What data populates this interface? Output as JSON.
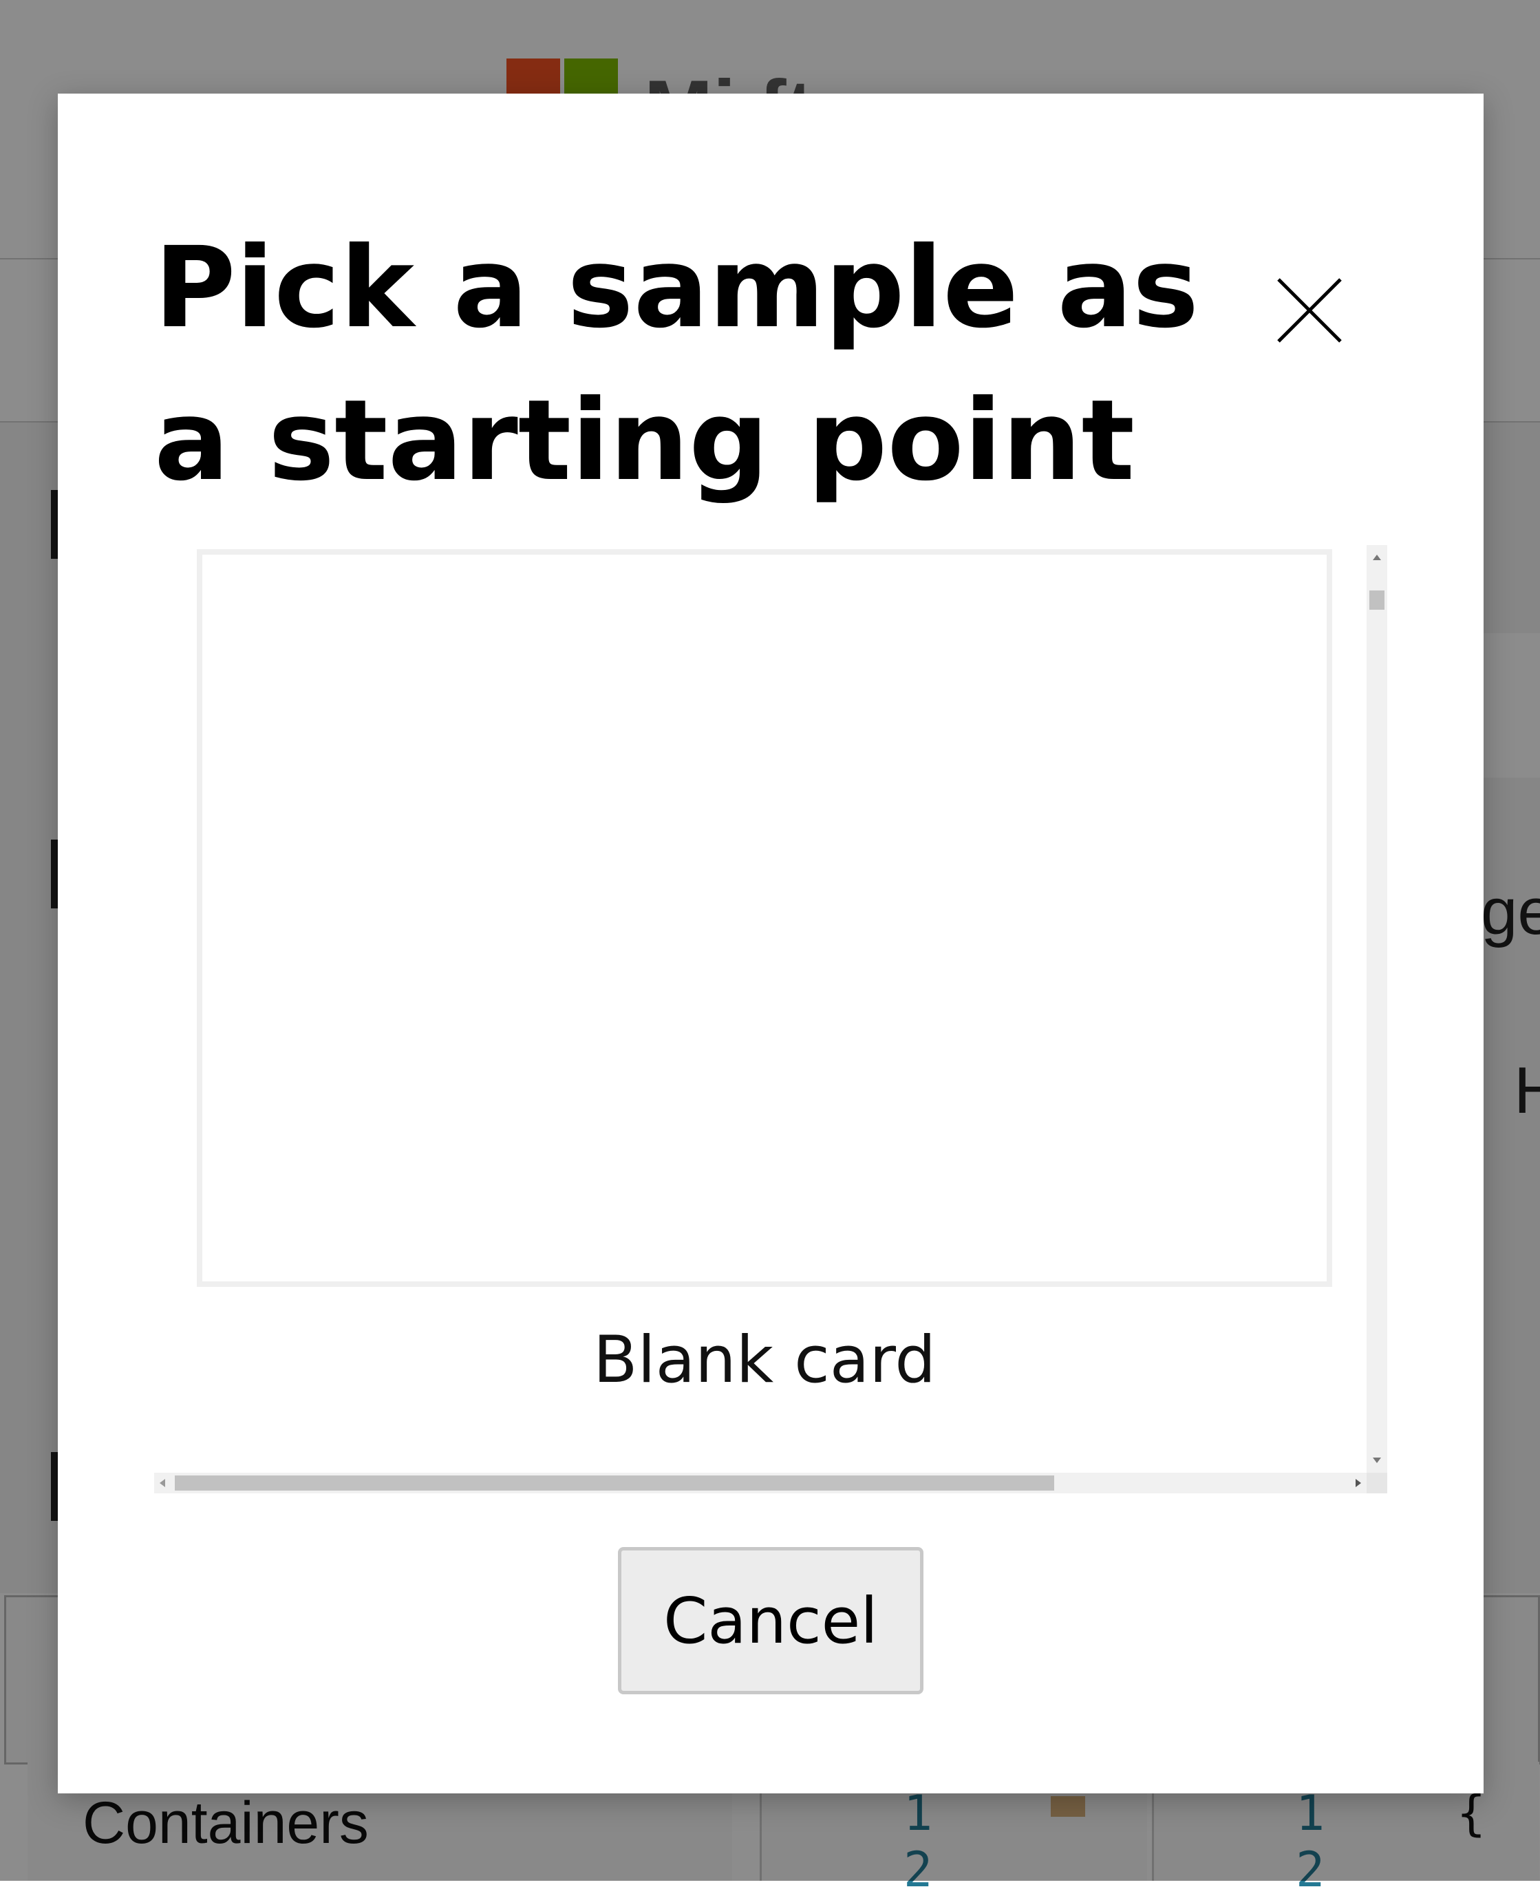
{
  "background": {
    "brand_partial": "Mi     ft",
    "right_fragment_1": "ge",
    "right_fragment_2": "H",
    "containers_label": "Containers",
    "editor_line_1": "1",
    "editor_line_2": "2",
    "brace": "{"
  },
  "dialog": {
    "title": "Pick a sample as a starting point",
    "close_icon": "close-icon",
    "samples": [
      {
        "label": "Blank card"
      }
    ],
    "cancel_label": "Cancel"
  },
  "colors": {
    "overlay": "rgba(0,0,0,0.45)",
    "card_border": "#efefef",
    "button_bg": "#ececec",
    "button_border": "#c8c8c8"
  }
}
